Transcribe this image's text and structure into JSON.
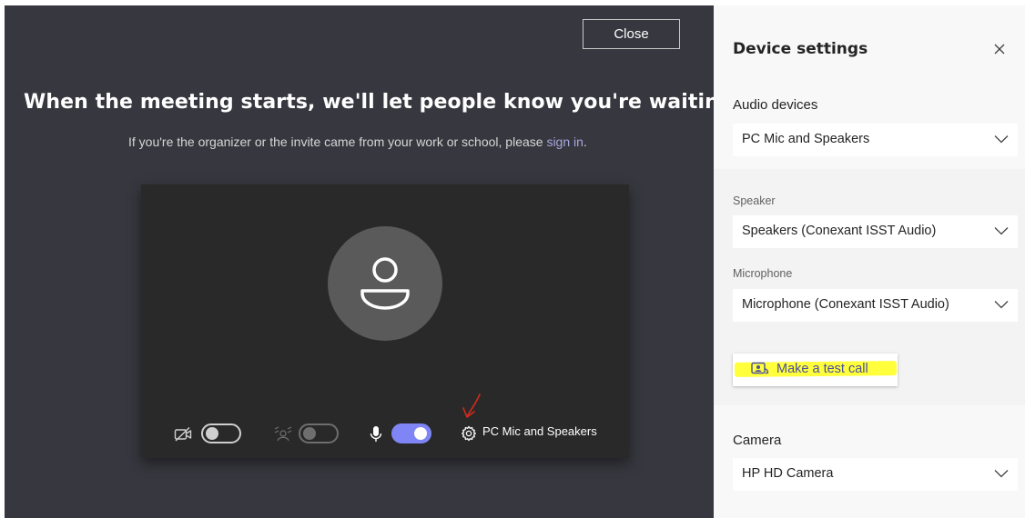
{
  "meeting": {
    "close_label": "Close",
    "headline": "When the meeting starts, we'll let people know you're waiting.",
    "subline_prefix": "If you're the organizer or the invite came from your work or school, please ",
    "subline_link": "sign in",
    "subline_suffix": ".",
    "controls": {
      "camera_icon": "camera-off-icon",
      "camera_on": false,
      "blur_icon": "background-blur-icon",
      "blur_on": false,
      "mic_icon": "microphone-icon",
      "mic_on": true,
      "settings_icon": "gear-icon",
      "device_label": "PC Mic and Speakers"
    }
  },
  "panel": {
    "title": "Device settings",
    "audio_devices_label": "Audio devices",
    "audio_devices_value": "PC Mic and Speakers",
    "speaker_label": "Speaker",
    "speaker_value": "Speakers (Conexant ISST Audio)",
    "microphone_label": "Microphone",
    "microphone_value": "Microphone (Conexant ISST Audio)",
    "test_call_label": "Make a test call",
    "camera_label": "Camera",
    "camera_value": "HP HD Camera"
  },
  "colors": {
    "meeting_bg": "#37373f",
    "preview_bg": "#292929",
    "accent": "#7f85f5",
    "link": "#a6a7dc",
    "highlight": "#ffff3b",
    "annotation": "#d12a1d"
  }
}
